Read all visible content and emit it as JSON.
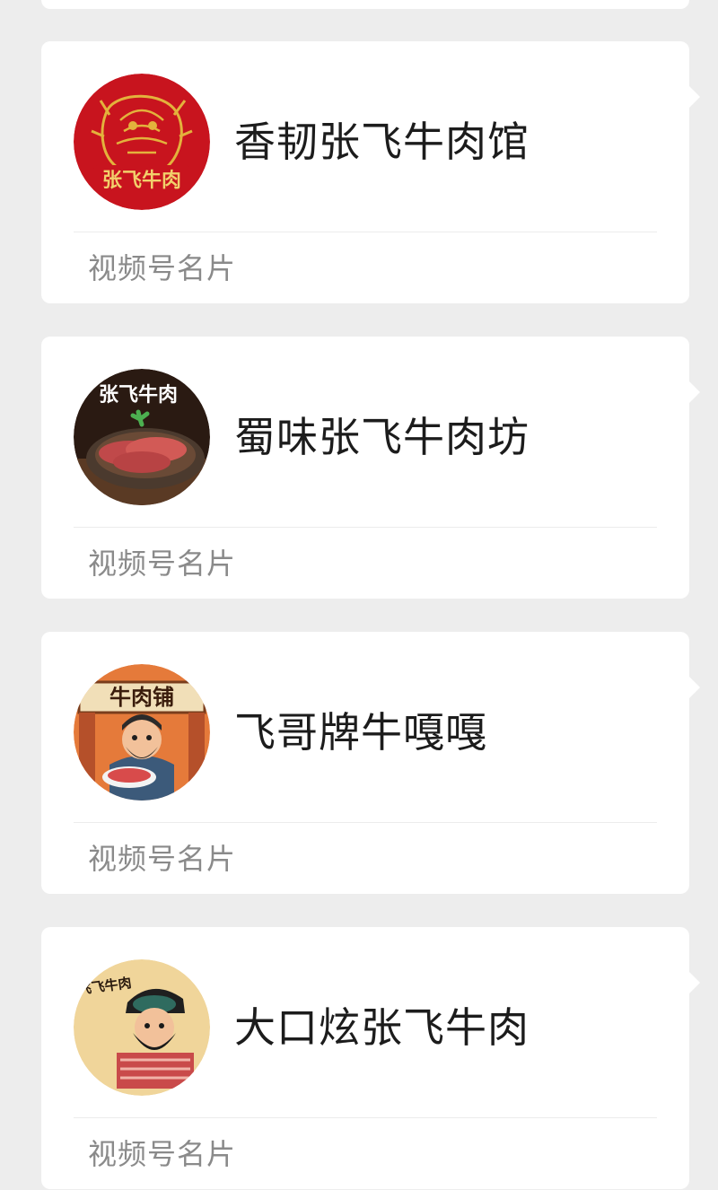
{
  "cards": [
    {
      "name": "香韧张飞牛肉馆",
      "footer": "视频号名片",
      "avatar_icon": "zhangfei-golden-seal-logo",
      "avatar_text": "张飞牛肉"
    },
    {
      "name": "蜀味张飞牛肉坊",
      "footer": "视频号名片",
      "avatar_icon": "sliced-beef-plate-photo",
      "avatar_text": "张飞牛肉"
    },
    {
      "name": "飞哥牌牛嘎嘎",
      "footer": "视频号名片",
      "avatar_icon": "beef-shop-cartoon-logo",
      "avatar_text": "牛肉铺"
    },
    {
      "name": "大口炫张飞牛肉",
      "footer": "视频号名片",
      "avatar_icon": "zhangfei-cartoon-logo",
      "avatar_text": "张飞飞牛肉"
    }
  ],
  "colors": {
    "background": "#ededed",
    "card": "#ffffff",
    "name_text": "#1c1c1c",
    "footer_text": "#8a8a8a",
    "logo_red": "#c8141e",
    "logo_gold": "#e3b23c"
  }
}
